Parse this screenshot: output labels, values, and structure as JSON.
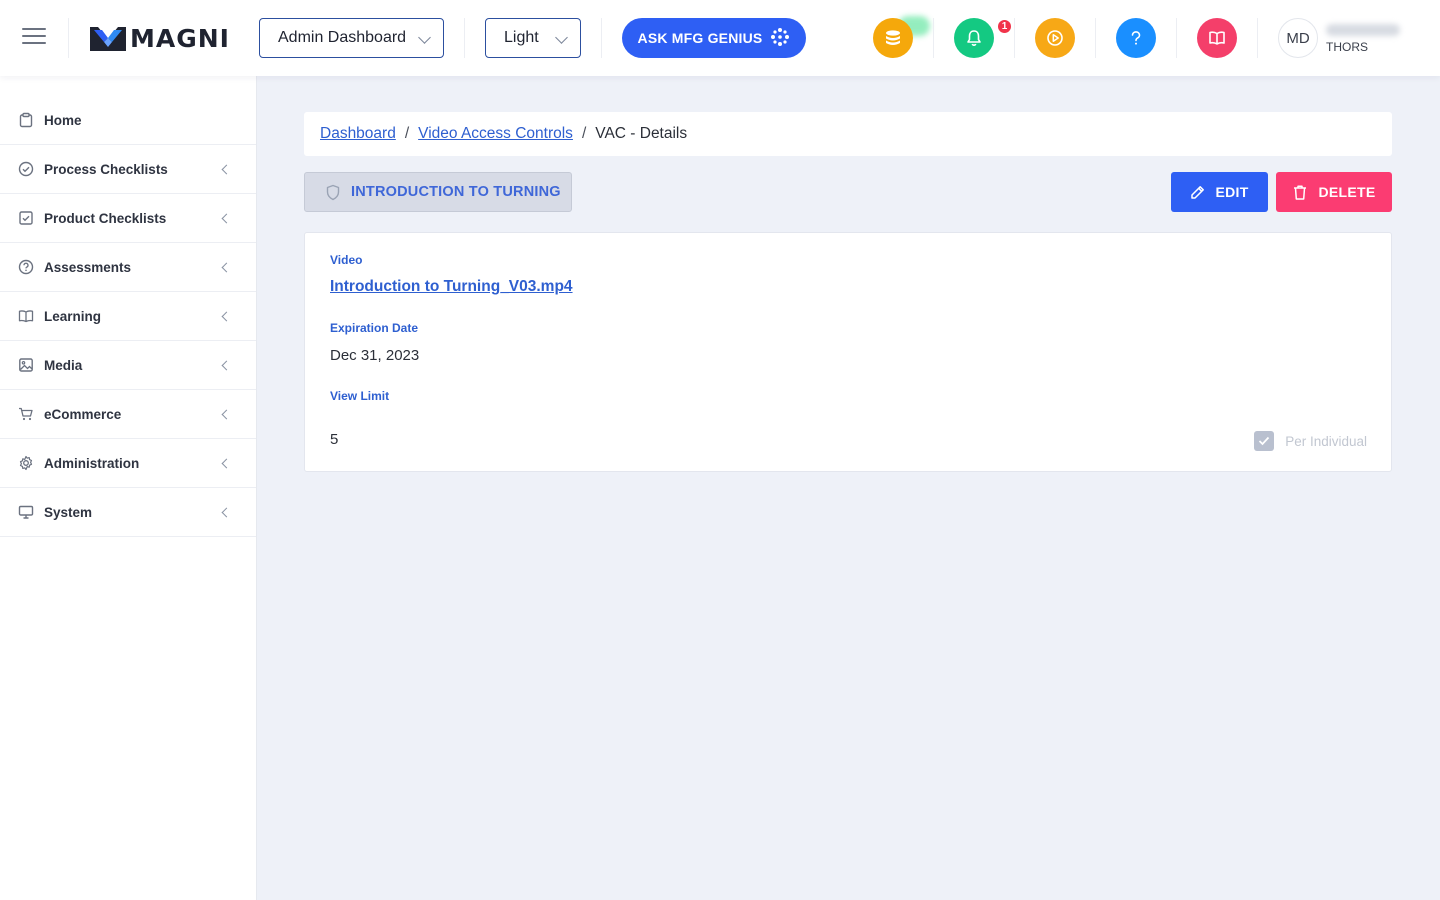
{
  "header": {
    "brand": "MAGNI",
    "dashboard_select": "Admin Dashboard",
    "theme_select": "Light",
    "genius_label": "ASK MFG GENIUS",
    "notification_count": "1",
    "avatar_initials": "MD",
    "user_org": "THORS",
    "icons": [
      "coins-icon",
      "bell-icon",
      "play-circle-icon",
      "help-icon",
      "book-icon"
    ],
    "colors": {
      "coins": "#f5a80b",
      "bell": "#14c982",
      "play": "#f7a816",
      "help": "#1a8fff",
      "book": "#f43f6a",
      "primary": "#2e5ff4"
    }
  },
  "sidebar": {
    "items": [
      {
        "label": "Home",
        "icon": "clipboard-icon"
      },
      {
        "label": "Process Checklists",
        "icon": "check-circle-icon"
      },
      {
        "label": "Product Checklists",
        "icon": "check-square-icon"
      },
      {
        "label": "Assessments",
        "icon": "question-circle-icon"
      },
      {
        "label": "Learning",
        "icon": "open-book-icon"
      },
      {
        "label": "Media",
        "icon": "image-icon"
      },
      {
        "label": "eCommerce",
        "icon": "cart-icon"
      },
      {
        "label": "Administration",
        "icon": "gear-icon"
      },
      {
        "label": "System",
        "icon": "monitor-icon"
      }
    ]
  },
  "breadcrumb": {
    "items": [
      "Dashboard",
      "Video Access Controls"
    ],
    "separator": "/",
    "current": "VAC - Details"
  },
  "page": {
    "title": "INTRODUCTION TO TURNING",
    "edit_label": "EDIT",
    "delete_label": "DELETE"
  },
  "details": {
    "video_label": "Video",
    "video_value": "Introduction to Turning_V03.mp4",
    "expiration_label": "Expiration Date",
    "expiration_value": "Dec 31, 2023",
    "view_limit_label": "View Limit",
    "view_limit_value": "5",
    "per_individual_label": "Per Individual",
    "per_individual_checked": true
  }
}
